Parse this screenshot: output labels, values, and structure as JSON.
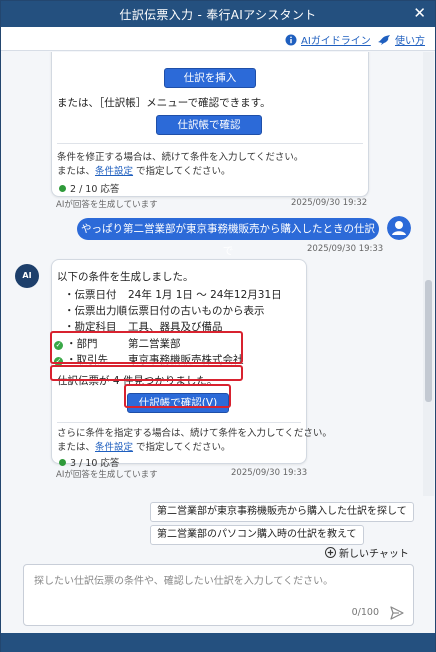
{
  "window": {
    "title": "仕訳伝票入力 - 奉行AIアシスタント",
    "close_glyph": "✕"
  },
  "toolbar": {
    "guideline_label": "AIガイドライン",
    "howto_label": "使い方"
  },
  "msg1": {
    "insert_button": "仕訳を挿入",
    "or_menu_text": "または、［仕訳帳］メニューで確認できます。",
    "confirm_button": "仕訳帳で確認",
    "modify_text": "条件を修正する場合は、続けて条件を入力してください。",
    "condition_prefix": "または、",
    "condition_link": "条件設定",
    "condition_suffix": " で指定してください。",
    "answer_count": "2 / 10 応答",
    "ai_notice": "AIが回答を生成しています",
    "timestamp": "2025/09/30 19:32"
  },
  "user_msg": {
    "text": "やっぱり第二営業部が東京事務機販売から購入したときの仕訳で",
    "timestamp": "2025/09/30 19:33"
  },
  "ai_avatar": {
    "label": "AI"
  },
  "msg2": {
    "intro": "以下の条件を生成しました。",
    "conditions": [
      {
        "key": "伝票日付",
        "value": "24年 1月 1日 ～ 24年12月31日"
      },
      {
        "key": "伝票出力順",
        "value": "伝票日付の古いものから表示"
      },
      {
        "key": "勘定科目",
        "value": "工具、器具及び備品"
      },
      {
        "key": "部門",
        "value": "第二営業部"
      },
      {
        "key": "取引先",
        "value": "東京事務機販売株式会社"
      }
    ],
    "bullet": "・",
    "check_glyph": "✓",
    "found_text": "仕訳伝票が 4 件見つかりました。",
    "confirm_button": "仕訳帳で確認(V)",
    "more_text": "さらに条件を指定する場合は、続けて条件を入力してください。",
    "condition_prefix": "または、",
    "condition_link": "条件設定",
    "condition_suffix": " で指定してください。",
    "answer_count": "3 / 10 応答",
    "ai_notice": "AIが回答を生成しています",
    "timestamp": "2025/09/30 19:33"
  },
  "suggestions": [
    "第二営業部が東京事務機販売から購入した仕訳を探して",
    "第二営業部のパソコン購入時の仕訳を教えて"
  ],
  "new_chat": {
    "label": "新しいチャット"
  },
  "input": {
    "placeholder": "探したい仕訳伝票の条件や、確認したい仕訳を入力してください。",
    "counter": "0/100"
  },
  "colors": {
    "titlebar": "#24507f",
    "accent": "#2c6ad8",
    "highlight": "#d8222f",
    "success": "#3aa847"
  }
}
